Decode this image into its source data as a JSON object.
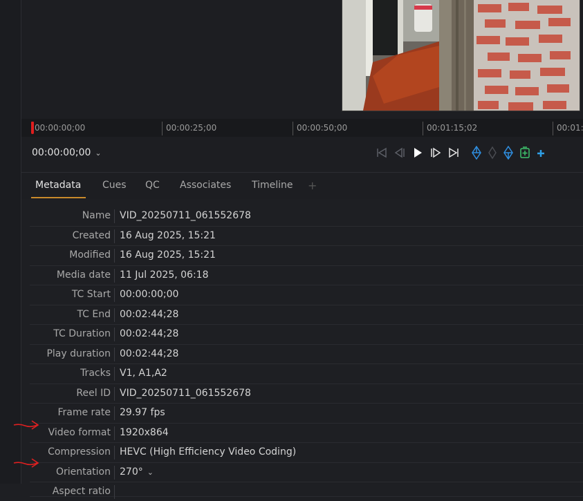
{
  "ruler": {
    "ticks": [
      "00:00:00;00",
      "00:00:25;00",
      "00:00:50;00",
      "00:01:15;02",
      "00:01:"
    ]
  },
  "transport": {
    "timecode": "00:00:00;00"
  },
  "tabs": {
    "items": [
      "Metadata",
      "Cues",
      "QC",
      "Associates",
      "Timeline"
    ],
    "add": "+"
  },
  "metadata": {
    "rows": [
      {
        "label": "Name",
        "value": "VID_20250711_061552678"
      },
      {
        "label": "Created",
        "value": "16 Aug 2025, 15:21"
      },
      {
        "label": "Modified",
        "value": "16 Aug 2025, 15:21"
      },
      {
        "label": "Media date",
        "value": "11 Jul 2025, 06:18"
      },
      {
        "label": "TC Start",
        "value": "00:00:00;00"
      },
      {
        "label": "TC End",
        "value": "00:02:44;28"
      },
      {
        "label": "TC Duration",
        "value": "00:02:44;28"
      },
      {
        "label": "Play duration",
        "value": "00:02:44;28"
      },
      {
        "label": "Tracks",
        "value": "V1, A1,A2"
      },
      {
        "label": "Reel ID",
        "value": "VID_20250711_061552678"
      },
      {
        "label": "Frame rate",
        "value": "29.97 fps"
      },
      {
        "label": "Video format",
        "value": "1920x864"
      },
      {
        "label": "Compression",
        "value": "HEVC (High Efficiency Video Coding)"
      },
      {
        "label": "Orientation",
        "value": "270°"
      },
      {
        "label": "Aspect ratio",
        "value": ""
      }
    ]
  },
  "icons": {
    "timecode_dropdown": "chevron-down-icon",
    "orientation_dropdown": "chevron-down-icon",
    "controls": [
      "go-to-start-icon",
      "step-back-icon",
      "play-icon",
      "step-forward-icon",
      "go-to-end-icon",
      "mark-in-icon",
      "marker-icon",
      "mark-out-icon",
      "add-clip-icon",
      "add-icon"
    ]
  },
  "colors": {
    "accent_tab": "#c98a2b",
    "playhead": "#e01e1e",
    "mark_blue": "#2f8fe0",
    "add_green": "#3ec46d",
    "annotation_red": "#e02020"
  }
}
